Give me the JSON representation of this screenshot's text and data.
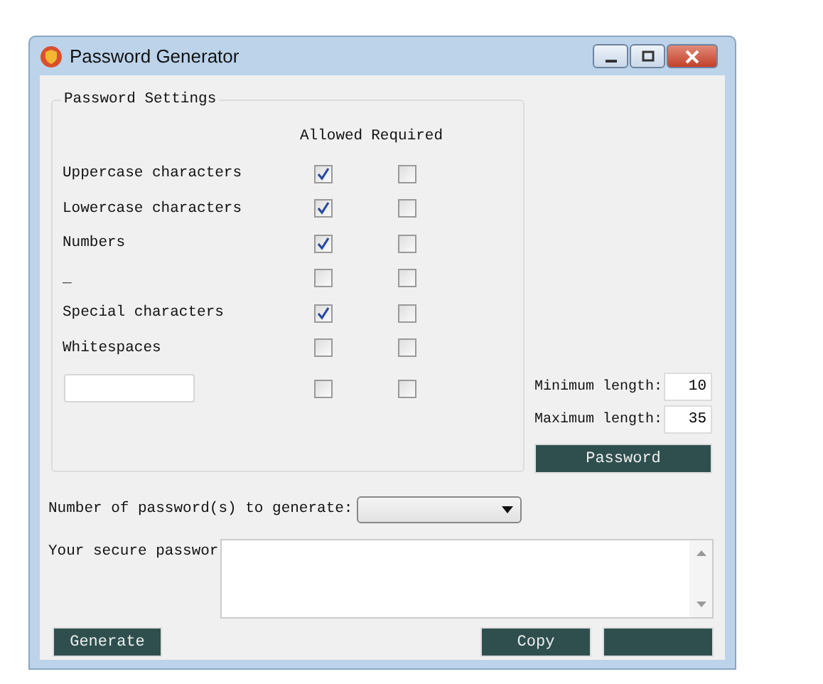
{
  "window": {
    "title": "Password Generator"
  },
  "settings": {
    "title": "Password Settings",
    "columns": [
      "Allowed",
      "Required"
    ],
    "rows": [
      {
        "kind": "label",
        "label": "Uppercase characters",
        "allowed": true,
        "required": false
      },
      {
        "kind": "label",
        "label": "Lowercase characters",
        "allowed": true,
        "required": false
      },
      {
        "kind": "label",
        "label": "Numbers",
        "allowed": true,
        "required": false
      },
      {
        "kind": "label",
        "label": "_",
        "allowed": false,
        "required": false
      },
      {
        "kind": "label",
        "label": "Special characters",
        "allowed": true,
        "required": false
      },
      {
        "kind": "label",
        "label": "Whitespaces",
        "allowed": false,
        "required": false
      },
      {
        "kind": "input",
        "allowed": false,
        "required": false
      }
    ]
  },
  "length": {
    "min_label": "Minimum length:",
    "min_value": "10",
    "max_label": "Maximum length:",
    "max_value": "35"
  },
  "password_button": "Password",
  "count": {
    "label": "Number of password(s) to generate:"
  },
  "output": {
    "label": "Your secure passwor"
  },
  "buttons": [
    "Generate",
    "Copy"
  ]
}
